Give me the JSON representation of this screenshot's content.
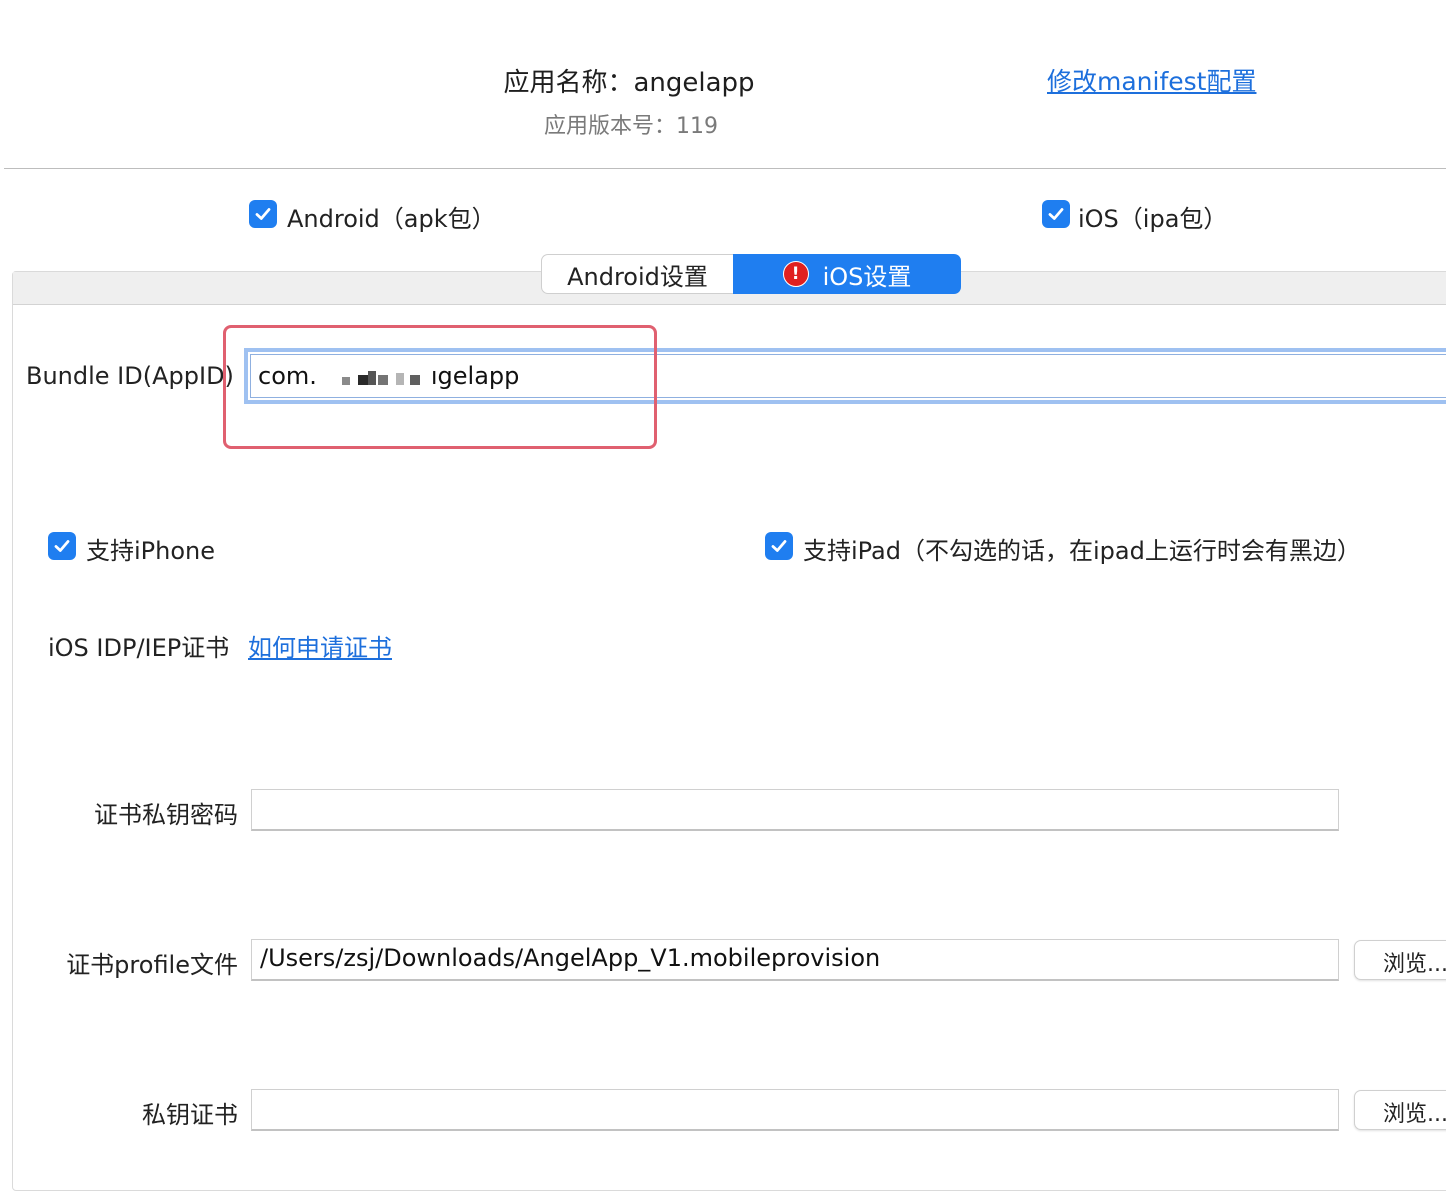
{
  "header": {
    "app_name": "应用名称：angelapp",
    "app_version": "应用版本号：119",
    "manifest_link": "修改manifest配置"
  },
  "platforms": {
    "android": {
      "label": "Android（apk包）",
      "checked": true
    },
    "ios": {
      "label": "iOS（ipa包）",
      "checked": true
    }
  },
  "tabs": [
    {
      "label": "Android设置",
      "active": false
    },
    {
      "label": "iOS设置",
      "active": true,
      "badge": "!"
    }
  ],
  "ios_settings": {
    "bundle_id": {
      "label": "Bundle ID(AppID)",
      "value_prefix": "com.",
      "value_suffix": "ıgelapp"
    },
    "support_iphone": {
      "label": "支持iPhone",
      "checked": true
    },
    "support_ipad": {
      "label": "支持iPad（不勾选的话，在ipad上运行时会有黑边）",
      "checked": true
    },
    "cert_section": {
      "label": "iOS IDP/IEP证书",
      "help_link": "如何申请证书"
    },
    "cert_password": {
      "label": "证书私钥密码",
      "value": ""
    },
    "profile_file": {
      "label": "证书profile文件",
      "value": "/Users/zsj/Downloads/AngelApp_V1.mobileprovision",
      "browse_label": "浏览..."
    },
    "private_key": {
      "label": "私钥证书",
      "value": "",
      "browse_label": "浏览..."
    }
  },
  "colors": {
    "accent": "#1f7ef0",
    "link": "#1d6fdc",
    "error": "#e02020",
    "highlight": "#e06070"
  }
}
